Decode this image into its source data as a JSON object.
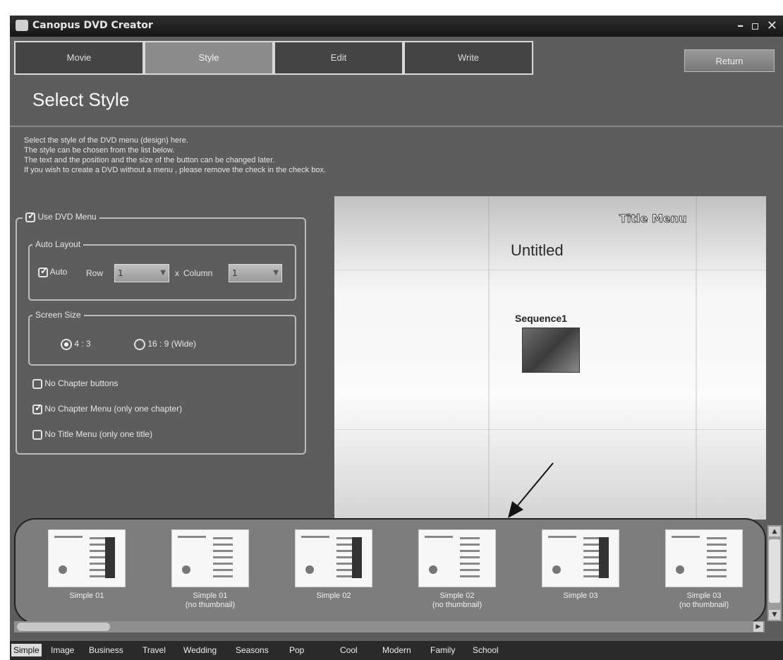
{
  "window": {
    "title": "Canopus DVD Creator",
    "controls": "– ▫ ✕"
  },
  "tabs": [
    "Movie",
    "Style",
    "Edit",
    "Write"
  ],
  "return_label": "Return",
  "page_title": "Select Style",
  "description": [
    "Select the style of the DVD menu (design) here.",
    "The style can be chosen from the list below.",
    "The text and the position and the size of the button can be changed later.",
    "If you wish to create a DVD without a menu , please remove the check in the check box."
  ],
  "menu_group": {
    "use_dvd_menu": "Use DVD Menu",
    "auto_layout": {
      "legend": "Auto Layout",
      "auto": "Auto",
      "row": "Row",
      "x": "x",
      "column": "Column",
      "row_value": "1",
      "column_value": "1"
    },
    "screen_size": {
      "legend": "Screen Size",
      "opt1": "4 : 3",
      "opt2": "16 : 9 (Wide)"
    },
    "no_chapter_buttons": "No Chapter buttons",
    "no_chapter_menu": "No Chapter Menu (only one chapter)",
    "no_title_menu": "No Title Menu (only one title)"
  },
  "preview": {
    "title_menu": "Title Menu",
    "untitled": "Untitled",
    "sequence": "Sequence1"
  },
  "styles": [
    {
      "name": "Simple 01",
      "sub": ""
    },
    {
      "name": "Simple 01",
      "sub": "(no thumbnail)"
    },
    {
      "name": "Simple 02",
      "sub": ""
    },
    {
      "name": "Simple 02",
      "sub": "(no thumbnail)"
    },
    {
      "name": "Simple 03",
      "sub": ""
    },
    {
      "name": "Simple 03",
      "sub": "(no thumbnail)"
    }
  ],
  "categories": [
    "Simple",
    "Image",
    "Business",
    "Travel",
    "Wedding",
    "Seasons",
    "Pop",
    "Cool",
    "Modern",
    "Family",
    "School"
  ]
}
